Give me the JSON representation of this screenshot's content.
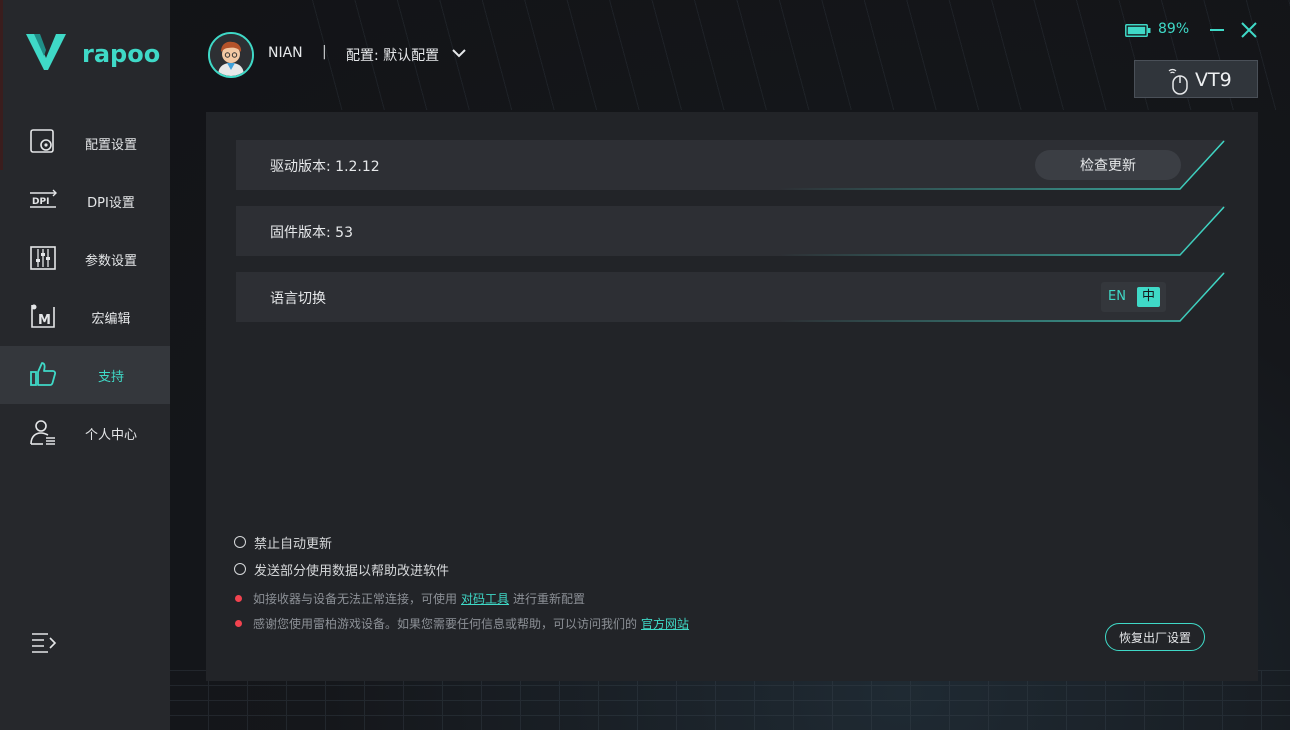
{
  "brand": {
    "name": "rapoo",
    "accent": "#3fd9c7"
  },
  "sidebar": {
    "items": [
      {
        "label": "配置设置",
        "icon": "profile-settings-icon",
        "active": false
      },
      {
        "label": "DPI设置",
        "icon": "dpi-icon",
        "active": false
      },
      {
        "label": "参数设置",
        "icon": "sliders-icon",
        "active": false
      },
      {
        "label": "宏编辑",
        "icon": "macro-icon",
        "active": false
      },
      {
        "label": "支持",
        "icon": "thumbs-up-icon",
        "active": true
      },
      {
        "label": "个人中心",
        "icon": "user-center-icon",
        "active": false
      }
    ],
    "menu_icon": "menu-collapse-icon"
  },
  "header": {
    "username": "NIAN",
    "separator": "|",
    "profile": "配置: 默认配置",
    "battery": "89%",
    "battery_level": 0.89,
    "device": "VT9"
  },
  "rows": {
    "driver": {
      "label": "驱动版本: 1.2.12",
      "button": "检查更新"
    },
    "firmware": {
      "label": "固件版本:  53"
    },
    "language": {
      "label": "语言切换",
      "en": "EN",
      "zh": "中",
      "selected": "中"
    }
  },
  "options": [
    {
      "label": "禁止自动更新",
      "checked": false
    },
    {
      "label": "发送部分使用数据以帮助改进软件",
      "checked": false
    }
  ],
  "notes": {
    "pairing": {
      "before": "如接收器与设备无法正常连接，可使用",
      "link": "对码工具",
      "after": "进行重新配置"
    },
    "thanks": {
      "before": "感谢您使用雷柏游戏设备。如果您需要任何信息或帮助，可以访问我们的",
      "link": "官方网站"
    }
  },
  "reset_button": "恢复出厂设置"
}
